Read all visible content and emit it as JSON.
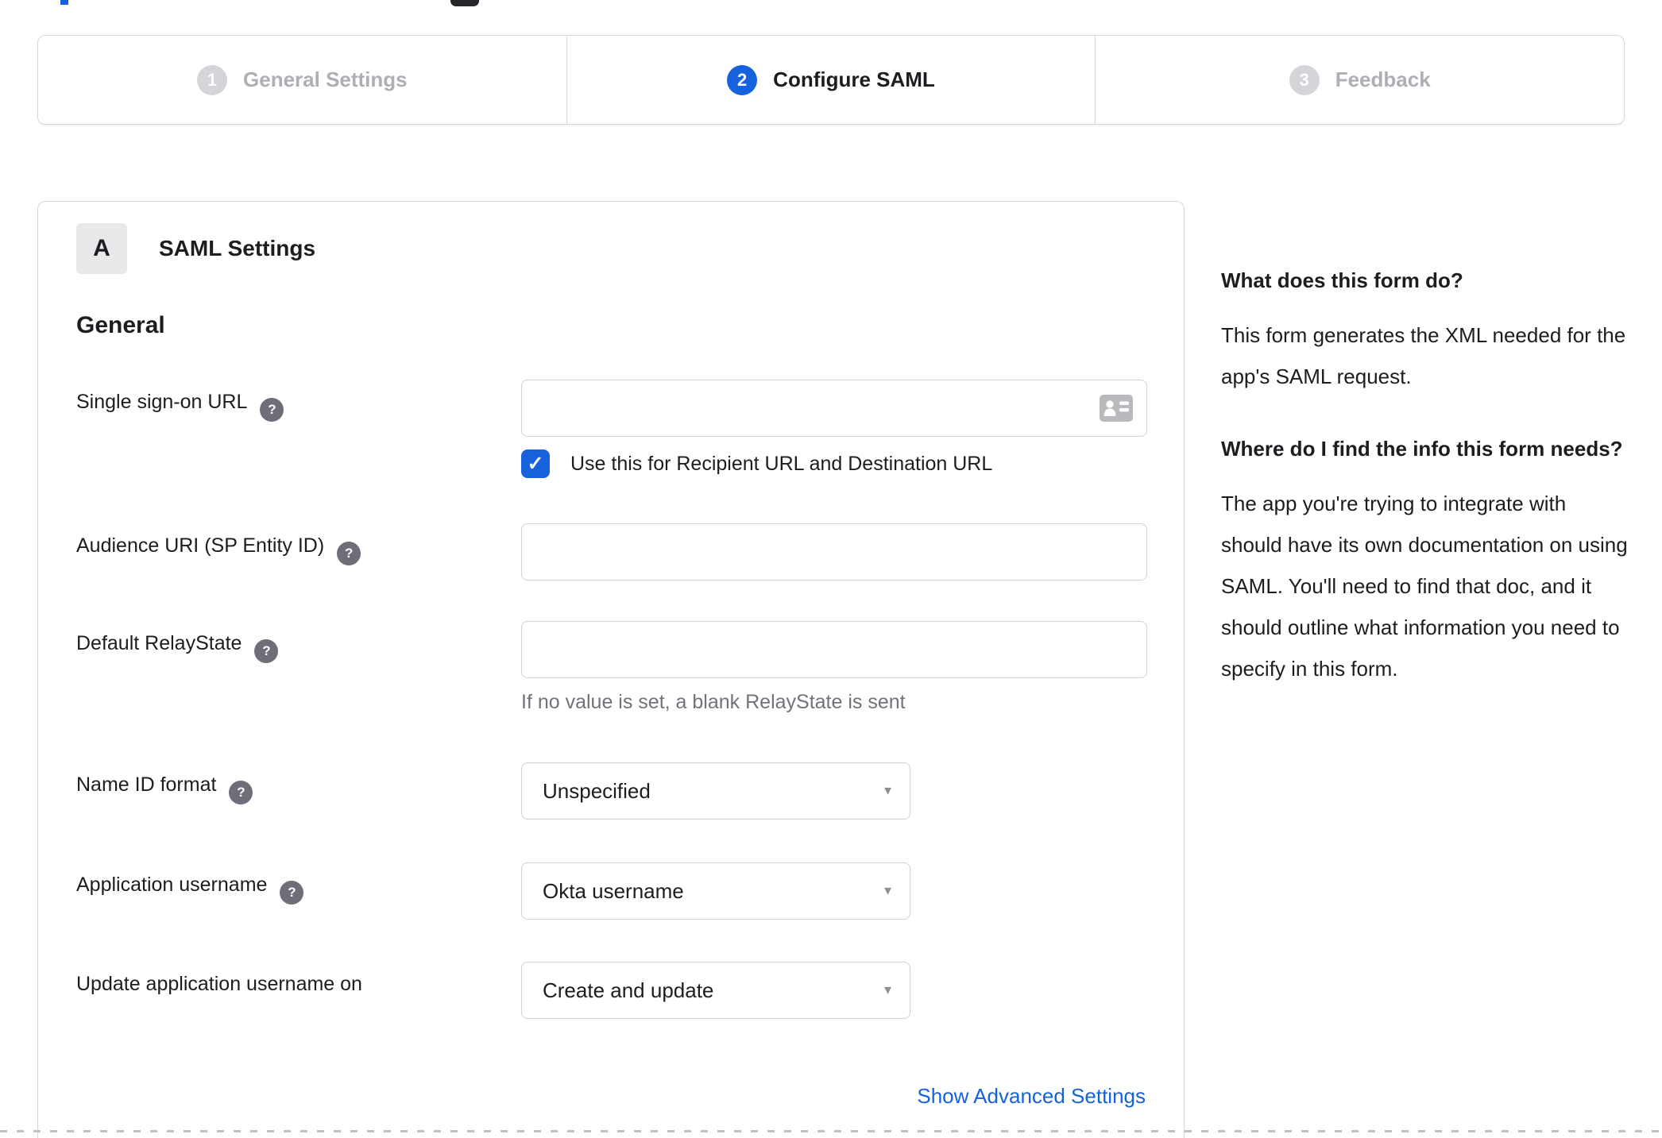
{
  "colors": {
    "accent_blue": "#1662dd",
    "text_dark": "#1d1d21",
    "inactive_gray": "#aeaeb4",
    "border_gray": "#d7d7dc"
  },
  "stepper": {
    "steps": [
      {
        "number": "1",
        "label": "General Settings",
        "state": "inactive"
      },
      {
        "number": "2",
        "label": "Configure SAML",
        "state": "active"
      },
      {
        "number": "3",
        "label": "Feedback",
        "state": "inactive"
      }
    ]
  },
  "form_card": {
    "section_badge": "A",
    "section_title": "SAML Settings",
    "group_title": "General",
    "help_icon_glyph": "?",
    "advanced_link": "Show Advanced Settings"
  },
  "fields": {
    "sso_url": {
      "label": "Single sign-on URL",
      "value": "",
      "checkbox_label": "Use this for Recipient URL and Destination URL",
      "checkbox_checked": true,
      "check_glyph": "✓"
    },
    "audience_uri": {
      "label": "Audience URI (SP Entity ID)",
      "value": ""
    },
    "relay_state": {
      "label": "Default RelayState",
      "value": "",
      "hint": "If no value is set, a blank RelayState is sent"
    },
    "name_id_format": {
      "label": "Name ID format",
      "value": "Unspecified"
    },
    "app_username": {
      "label": "Application username",
      "value": "Okta username"
    },
    "update_app_username": {
      "label": "Update application username on",
      "value": "Create and update"
    },
    "caret_glyph": "▼"
  },
  "sidebar": {
    "sections": [
      {
        "heading": "What does this form do?",
        "body": "This form generates the XML needed for the app's SAML request."
      },
      {
        "heading": "Where do I find the info this form needs?",
        "body": "The app you're trying to integrate with should have its own documentation on using SAML. You'll need to find that doc, and it should outline what information you need to specify in this form."
      }
    ]
  }
}
